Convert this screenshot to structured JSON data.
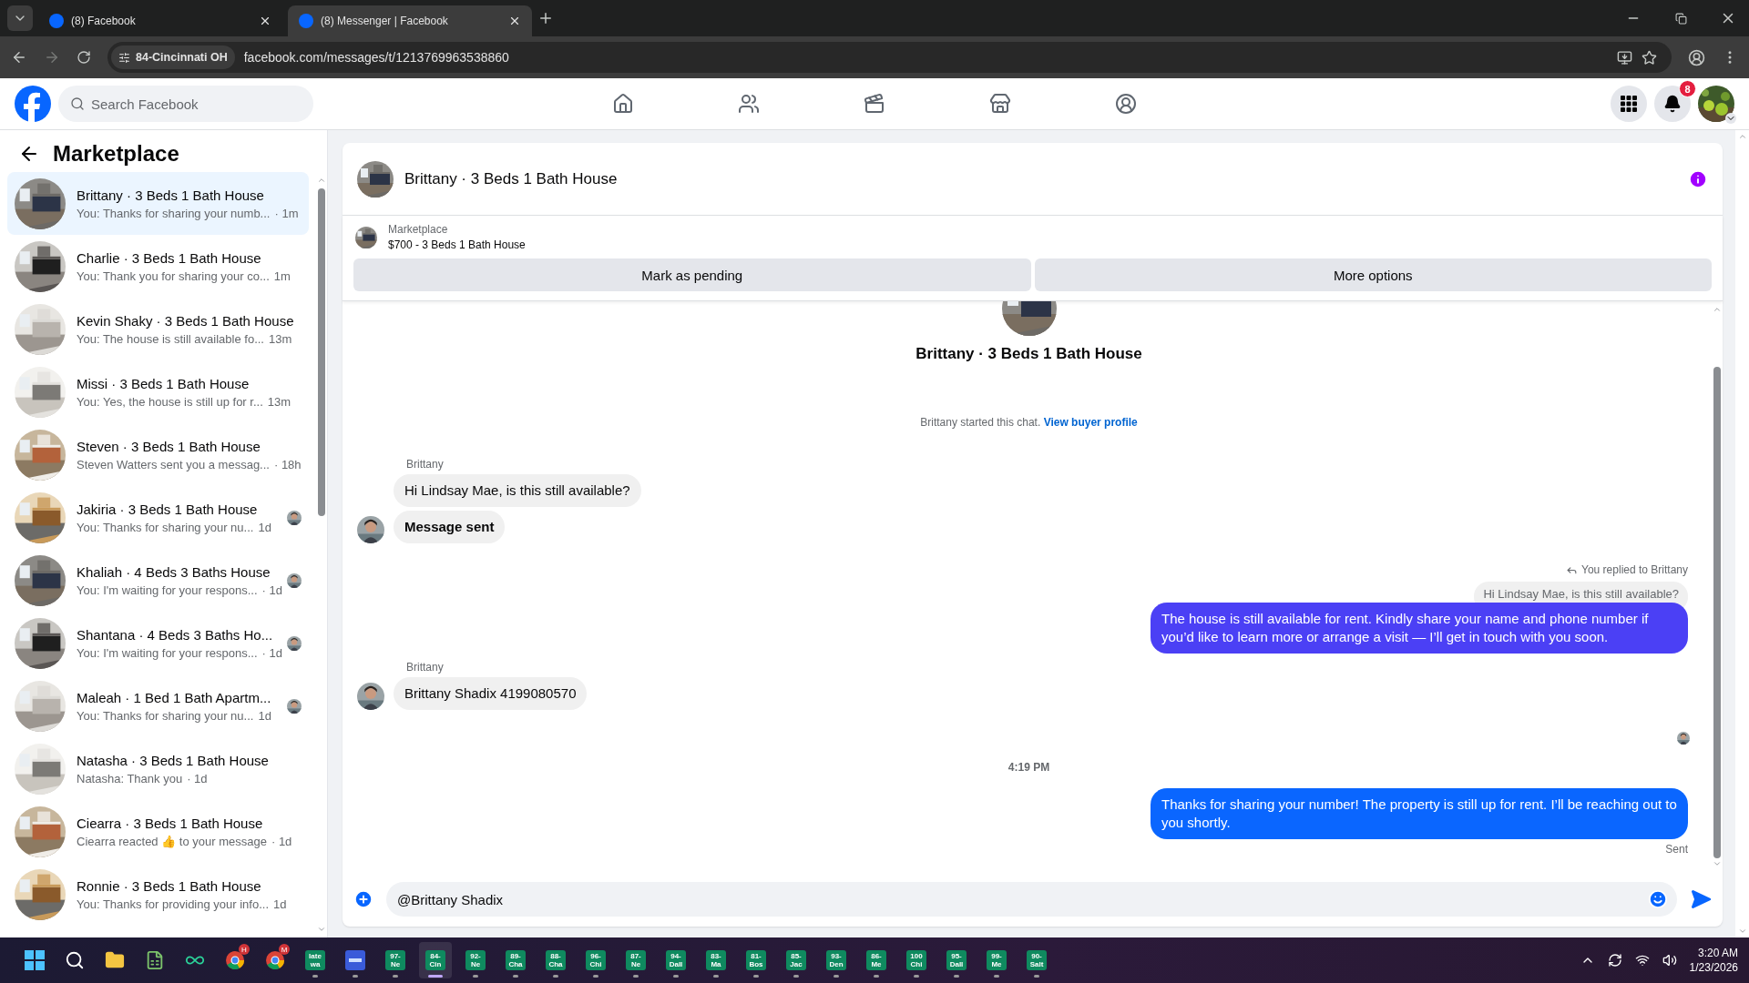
{
  "browser": {
    "tabs": [
      {
        "title": "(8) Facebook",
        "selected": false
      },
      {
        "title": "(8) Messenger | Facebook",
        "selected": true
      }
    ],
    "site_chip": "84-Cincinnati OH",
    "url": "facebook.com/messages/t/1213769963538860"
  },
  "header": {
    "search": {
      "placeholder": "Search Facebook"
    },
    "notification_count": "8"
  },
  "sidebar": {
    "title": "Marketplace",
    "conversations": [
      {
        "name": "Brittany · 3 Beds 1 Bath House",
        "preview": "You: Thanks for sharing your numb...",
        "time": "· 1m",
        "selected": true,
        "seen": false
      },
      {
        "name": "Charlie · 3 Beds 1 Bath House",
        "preview": "You: Thank you for sharing your co...",
        "time": "1m",
        "selected": false,
        "seen": false
      },
      {
        "name": "Kevin Shaky · 3 Beds 1 Bath House",
        "preview": "You: The house is still available fo...",
        "time": "13m",
        "selected": false,
        "seen": false
      },
      {
        "name": "Missi · 3 Beds 1 Bath House",
        "preview": "You: Yes, the house is still up for r...",
        "time": "13m",
        "selected": false,
        "seen": false
      },
      {
        "name": "Steven · 3 Beds 1 Bath House",
        "preview": "Steven Watters sent you a messag...",
        "time": "· 18h",
        "selected": false,
        "seen": false
      },
      {
        "name": "Jakiria · 3 Beds 1 Bath House",
        "preview": "You: Thanks for sharing your nu...",
        "time": "1d",
        "selected": false,
        "seen": true
      },
      {
        "name": "Khaliah · 4 Beds 3 Baths House",
        "preview": "You: I'm waiting for your respons...",
        "time": "· 1d",
        "selected": false,
        "seen": true
      },
      {
        "name": "Shantana · 4 Beds 3 Baths Ho...",
        "preview": "You: I'm waiting for your respons...",
        "time": "· 1d",
        "selected": false,
        "seen": true
      },
      {
        "name": "Maleah · 1 Bed 1 Bath Apartm...",
        "preview": "You: Thanks for sharing your nu...",
        "time": "1d",
        "selected": false,
        "seen": true
      },
      {
        "name": "Natasha · 3 Beds 1 Bath House",
        "preview": "Natasha: Thank you",
        "time": "· 1d",
        "selected": false,
        "seen": false
      },
      {
        "name": "Ciearra · 3 Beds 1 Bath House",
        "preview": "Ciearra reacted 👍 to your message",
        "time": "· 1d",
        "selected": false,
        "seen": false
      },
      {
        "name": "Ronnie · 3 Beds 1 Bath House",
        "preview": "You: Thanks for providing your info...",
        "time": "1d",
        "selected": false,
        "seen": false
      }
    ]
  },
  "chat": {
    "title": "Brittany · 3 Beds 1 Bath House",
    "listing": {
      "label": "Marketplace",
      "title": "$700 - 3 Beds 1 Bath House",
      "buttons": [
        "Mark as pending",
        "More options"
      ]
    },
    "intro_name": "Brittany · 3 Beds 1 Bath House",
    "intro_text": "Brittany started this chat.",
    "intro_link": "View buyer profile",
    "messages": [
      {
        "kind": "sender",
        "text": "Brittany"
      },
      {
        "kind": "incoming",
        "text": "Hi Lindsay Mae, is this still available?",
        "avatar": false,
        "bold": false
      },
      {
        "kind": "incoming",
        "text": "Message sent",
        "avatar": true,
        "bold": true
      },
      {
        "kind": "reply_note",
        "text": "You replied to Brittany"
      },
      {
        "kind": "quote",
        "text": "Hi Lindsay Mae, is this still available?"
      },
      {
        "kind": "outgoing",
        "text": "The house is still available for rent. Kindly share your name and phone number if you’d like to learn more or arrange a visit — I’ll get in touch with you soon.",
        "color": "#4b40f5"
      },
      {
        "kind": "sender",
        "text": "Brittany"
      },
      {
        "kind": "incoming",
        "text": "Brittany Shadix 4199080570",
        "avatar": true,
        "bold": false
      },
      {
        "kind": "seen"
      },
      {
        "kind": "time",
        "text": "4:19 PM"
      },
      {
        "kind": "outgoing",
        "text": "Thanks for sharing your number! The property is still up for rent. I’ll be reaching out to you shortly.",
        "color": "#0a66ff"
      },
      {
        "kind": "status",
        "text": "Sent"
      }
    ],
    "composer": {
      "value": "@Brittany Shadix"
    }
  },
  "taskbar": {
    "apps": [
      {
        "kind": "files"
      },
      {
        "kind": "sheet"
      },
      {
        "kind": "loop"
      },
      {
        "kind": "chrome",
        "badge": "H"
      },
      {
        "kind": "chrome",
        "badge": "M"
      },
      {
        "kind": "label",
        "line1": "late",
        "line2": "wa",
        "active": false
      },
      {
        "kind": "tile",
        "active": false
      },
      {
        "kind": "label",
        "line1": "97-",
        "line2": "Ne",
        "active": false
      },
      {
        "kind": "label",
        "line1": "84-",
        "line2": "Cin",
        "active": true
      },
      {
        "kind": "label",
        "line1": "92-",
        "line2": "Ne",
        "active": false
      },
      {
        "kind": "label",
        "line1": "89-",
        "line2": "Cha",
        "active": false
      },
      {
        "kind": "label",
        "line1": "88-",
        "line2": "Cha",
        "active": false
      },
      {
        "kind": "label",
        "line1": "96-",
        "line2": "Chi",
        "active": false
      },
      {
        "kind": "label",
        "line1": "87-",
        "line2": "Ne",
        "active": false
      },
      {
        "kind": "label",
        "line1": "94-",
        "line2": "Dall",
        "active": false
      },
      {
        "kind": "label",
        "line1": "83-",
        "line2": "Ma",
        "active": false
      },
      {
        "kind": "label",
        "line1": "81-",
        "line2": "Bos",
        "active": false
      },
      {
        "kind": "label",
        "line1": "85-",
        "line2": "Jac",
        "active": false
      },
      {
        "kind": "label",
        "line1": "93-",
        "line2": "Den",
        "active": false
      },
      {
        "kind": "label",
        "line1": "86-",
        "line2": "Me",
        "active": false
      },
      {
        "kind": "label",
        "line1": "100",
        "line2": "Chi",
        "active": false
      },
      {
        "kind": "label",
        "line1": "95-",
        "line2": "Dall",
        "active": false
      },
      {
        "kind": "label",
        "line1": "99-",
        "line2": "Me",
        "active": false
      },
      {
        "kind": "label",
        "line1": "90-",
        "line2": "Salt",
        "active": false
      }
    ],
    "time": "3:20 AM",
    "date": "1/23/2026"
  }
}
